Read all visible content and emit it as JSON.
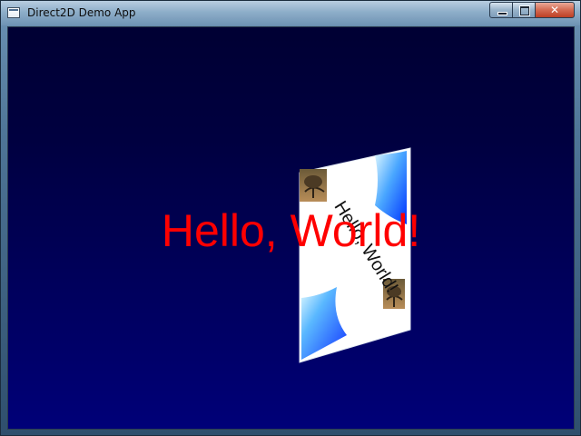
{
  "window": {
    "title": "Direct2D Demo App",
    "icon": "app-window-icon",
    "controls": {
      "minimize": "minimize-icon",
      "maximize": "maximize-icon",
      "close_label": "✕"
    }
  },
  "scene": {
    "headline": "Hello, World!",
    "headline_color": "#ff0000",
    "background_top": "#000033",
    "background_bottom": "#000078",
    "panel": {
      "text": "Hello, World!",
      "image_icon": "tree-photo-icon",
      "gradient_color": "#0033ff"
    }
  }
}
